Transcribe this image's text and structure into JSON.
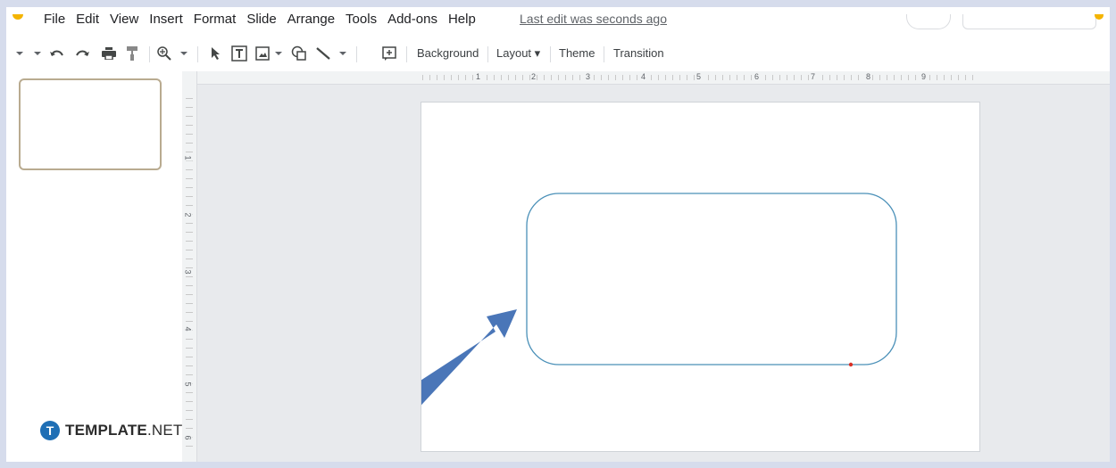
{
  "menu": {
    "items": [
      "File",
      "Edit",
      "View",
      "Insert",
      "Format",
      "Slide",
      "Arrange",
      "Tools",
      "Add-ons",
      "Help"
    ],
    "last_edit": "Last edit was seconds ago"
  },
  "toolbar": {
    "background_label": "Background",
    "layout_label": "Layout",
    "theme_label": "Theme",
    "transition_label": "Transition",
    "icons": [
      "dropdown-arrow-icon",
      "undo-icon",
      "redo-icon",
      "print-icon",
      "paint-format-icon",
      "zoom-icon",
      "select-icon",
      "text-box-icon",
      "image-icon",
      "shape-icon",
      "line-icon",
      "comment-icon"
    ]
  },
  "ruler": {
    "horizontal": [
      "1",
      "2",
      "3",
      "4",
      "5",
      "6",
      "7",
      "8",
      "9"
    ],
    "vertical": [
      "1",
      "2",
      "3",
      "4",
      "5",
      "6"
    ]
  },
  "brand": {
    "logo_letter": "T",
    "name": "TEMPLATE",
    "suffix": ".NET"
  },
  "colors": {
    "accent": "#f4b400",
    "shape_stroke": "#4a90b8",
    "arrow": "#4a76b8",
    "brand": "#1f6fb5"
  }
}
